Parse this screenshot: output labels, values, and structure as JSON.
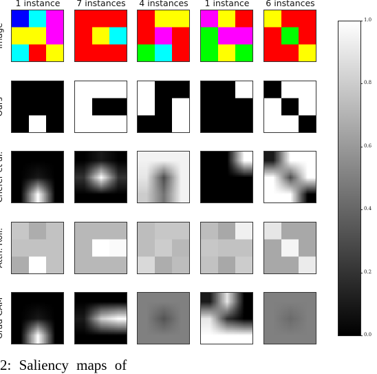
{
  "column_titles": [
    "1 instance",
    "7 instances",
    "4 instances",
    "1 instance",
    "6 instances"
  ],
  "row_labels": [
    "Image",
    "Ours",
    "Chefer et al.",
    "Attn. Roll.",
    "Grad-CAM"
  ],
  "colorbar": {
    "ticks": [
      "0.0",
      "0.2",
      "0.4",
      "0.6",
      "0.8",
      "1.0"
    ],
    "colormap": "gray",
    "range": [
      0,
      1
    ]
  },
  "palette": {
    "blue": "#0000ff",
    "cyan": "#00ffff",
    "magenta": "#ff00ff",
    "yellow": "#ffff00",
    "red": "#ff0000",
    "green": "#00ff00"
  },
  "images": [
    [
      [
        "blue",
        "cyan",
        "magenta"
      ],
      [
        "yellow",
        "yellow",
        "magenta"
      ],
      [
        "cyan",
        "red",
        "yellow"
      ]
    ],
    [
      [
        "red",
        "red",
        "red"
      ],
      [
        "red",
        "yellow",
        "cyan"
      ],
      [
        "red",
        "red",
        "red"
      ]
    ],
    [
      [
        "red",
        "yellow",
        "yellow"
      ],
      [
        "red",
        "magenta",
        "red"
      ],
      [
        "green",
        "cyan",
        "red"
      ]
    ],
    [
      [
        "magenta",
        "yellow",
        "red"
      ],
      [
        "green",
        "magenta",
        "magenta"
      ],
      [
        "green",
        "yellow",
        "green"
      ]
    ],
    [
      [
        "yellow",
        "red",
        "red"
      ],
      [
        "red",
        "green",
        "red"
      ],
      [
        "red",
        "red",
        "yellow"
      ]
    ]
  ],
  "saliency": {
    "ours": [
      [
        [
          0,
          0,
          0
        ],
        [
          0,
          0,
          0
        ],
        [
          0,
          1,
          0
        ]
      ],
      [
        [
          1,
          1,
          1
        ],
        [
          1,
          0,
          0
        ],
        [
          1,
          1,
          1
        ]
      ],
      [
        [
          1,
          0,
          0
        ],
        [
          1,
          0,
          1
        ],
        [
          0,
          0,
          1
        ]
      ],
      [
        [
          0,
          0,
          1
        ],
        [
          0,
          0,
          0
        ],
        [
          0,
          0,
          0
        ]
      ],
      [
        [
          0,
          1,
          1
        ],
        [
          1,
          0,
          1
        ],
        [
          1,
          1,
          0
        ]
      ]
    ],
    "chefer": [
      [
        [
          0,
          0,
          0
        ],
        [
          0,
          0.1,
          0
        ],
        [
          0,
          1,
          0
        ]
      ],
      [
        [
          0,
          0.1,
          0
        ],
        [
          0.2,
          1,
          0.2
        ],
        [
          0,
          0,
          0
        ]
      ],
      [
        [
          0.95,
          0.95,
          0.95
        ],
        [
          0.9,
          0.3,
          0.95
        ],
        [
          0.8,
          0.45,
          0.95
        ]
      ],
      [
        [
          0,
          0,
          1
        ],
        [
          0,
          0,
          0
        ],
        [
          0,
          0,
          0
        ]
      ],
      [
        [
          0.1,
          1,
          1
        ],
        [
          1,
          0.3,
          1
        ],
        [
          1,
          1,
          0
        ]
      ]
    ],
    "attn_roll": [
      [
        [
          0.78,
          0.68,
          0.76
        ],
        [
          0.76,
          0.76,
          0.76
        ],
        [
          0.68,
          1,
          0.76
        ]
      ],
      [
        [
          0.72,
          0.72,
          0.72
        ],
        [
          0.72,
          1,
          0.98
        ],
        [
          0.72,
          0.72,
          0.72
        ]
      ],
      [
        [
          0.74,
          0.78,
          0.78
        ],
        [
          0.74,
          0.8,
          0.72
        ],
        [
          0.85,
          0.68,
          0.74
        ]
      ],
      [
        [
          0.74,
          0.66,
          0.94
        ],
        [
          0.78,
          0.76,
          0.76
        ],
        [
          0.76,
          0.66,
          0.8
        ]
      ],
      [
        [
          0.9,
          0.66,
          0.66
        ],
        [
          0.66,
          0.96,
          0.66
        ],
        [
          0.66,
          0.66,
          0.92
        ]
      ]
    ],
    "gradcam": [
      [
        [
          0,
          0,
          0
        ],
        [
          0,
          0.1,
          0
        ],
        [
          0,
          1,
          0
        ]
      ],
      [
        [
          0,
          0,
          0
        ],
        [
          0.1,
          0.8,
          1
        ],
        [
          0,
          0,
          0
        ]
      ],
      [
        [
          0.5,
          0.5,
          0.5
        ],
        [
          0.5,
          0.33,
          0.5
        ],
        [
          0.5,
          0.5,
          0.5
        ]
      ],
      [
        [
          0.1,
          0.9,
          0
        ],
        [
          0.9,
          0.2,
          0
        ],
        [
          1,
          1,
          1
        ]
      ],
      [
        [
          0.5,
          0.5,
          0.5
        ],
        [
          0.5,
          0.42,
          0.5
        ],
        [
          0.5,
          0.5,
          0.5
        ]
      ]
    ]
  },
  "caption": "2: Saliency maps of"
}
